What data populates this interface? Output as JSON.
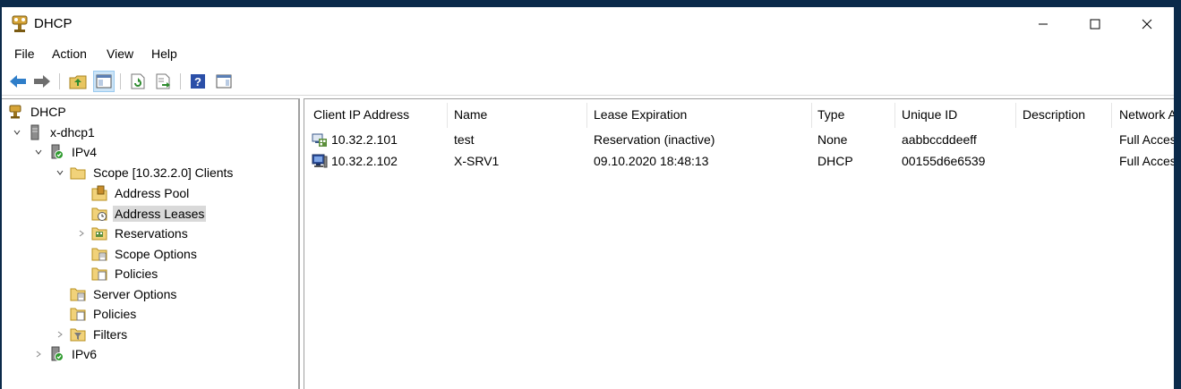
{
  "window": {
    "title": "DHCP"
  },
  "menu": [
    "File",
    "Action",
    "View",
    "Help"
  ],
  "tree": [
    {
      "label": "DHCP",
      "icon": "dhcp-icon"
    },
    {
      "label": "x-dhcp1",
      "icon": "server-icon"
    },
    {
      "label": "IPv4",
      "icon": "ipv4-icon"
    },
    {
      "label": "Scope [10.32.2.0] Clients",
      "icon": "folder-icon"
    },
    {
      "label": "Address Pool",
      "icon": "address-pool-icon"
    },
    {
      "label": "Address Leases",
      "icon": "address-leases-icon"
    },
    {
      "label": "Reservations",
      "icon": "reservations-icon"
    },
    {
      "label": "Scope Options",
      "icon": "scope-options-icon"
    },
    {
      "label": "Policies",
      "icon": "policies-icon"
    },
    {
      "label": "Server Options",
      "icon": "server-options-icon"
    },
    {
      "label": "Policies",
      "icon": "policies-icon"
    },
    {
      "label": "Filters",
      "icon": "filters-icon"
    },
    {
      "label": "IPv6",
      "icon": "ipv6-icon"
    }
  ],
  "table": {
    "columns": [
      "Client IP Address",
      "Name",
      "Lease Expiration",
      "Type",
      "Unique ID",
      "Description",
      "Network A"
    ],
    "rows": [
      {
        "ip": "10.32.2.101",
        "name": "test",
        "expiration": "Reservation (inactive)",
        "type": "None",
        "uid": "aabbccddeeff",
        "description": "",
        "network": "Full Acces"
      },
      {
        "ip": "10.32.2.102",
        "name": "X-SRV1",
        "expiration": "09.10.2020 18:48:13",
        "type": "DHCP",
        "uid": "00155d6e6539",
        "description": "",
        "network": "Full Acces"
      }
    ]
  },
  "colors": {
    "selection": "#d9d9d9",
    "toolbarActive": "#cce4f7",
    "desktop": "#0b2a4a"
  }
}
